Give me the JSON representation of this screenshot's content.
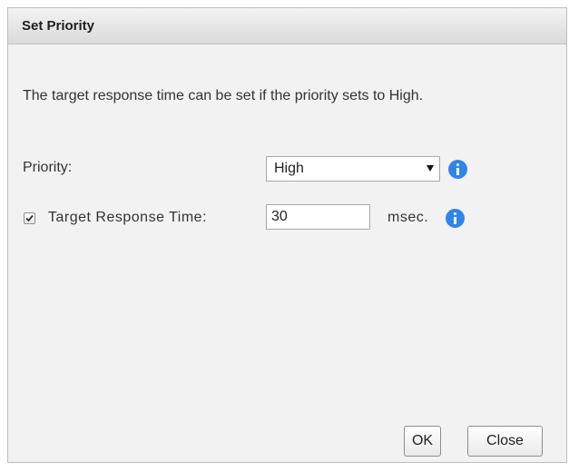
{
  "dialog": {
    "title": "Set Priority",
    "description": "The target response time can be set if the priority sets to High."
  },
  "priority": {
    "label": "Priority:",
    "selected": "High",
    "info_icon": "info-icon"
  },
  "target_response": {
    "checked": true,
    "label": "Target Response Time:",
    "value": "30",
    "unit": "msec.",
    "info_icon": "info-icon"
  },
  "buttons": {
    "ok_label": "OK",
    "close_label": "Close"
  },
  "colors": {
    "info_icon": "#2f86e8",
    "dialog_background": "#f2f2f2"
  }
}
